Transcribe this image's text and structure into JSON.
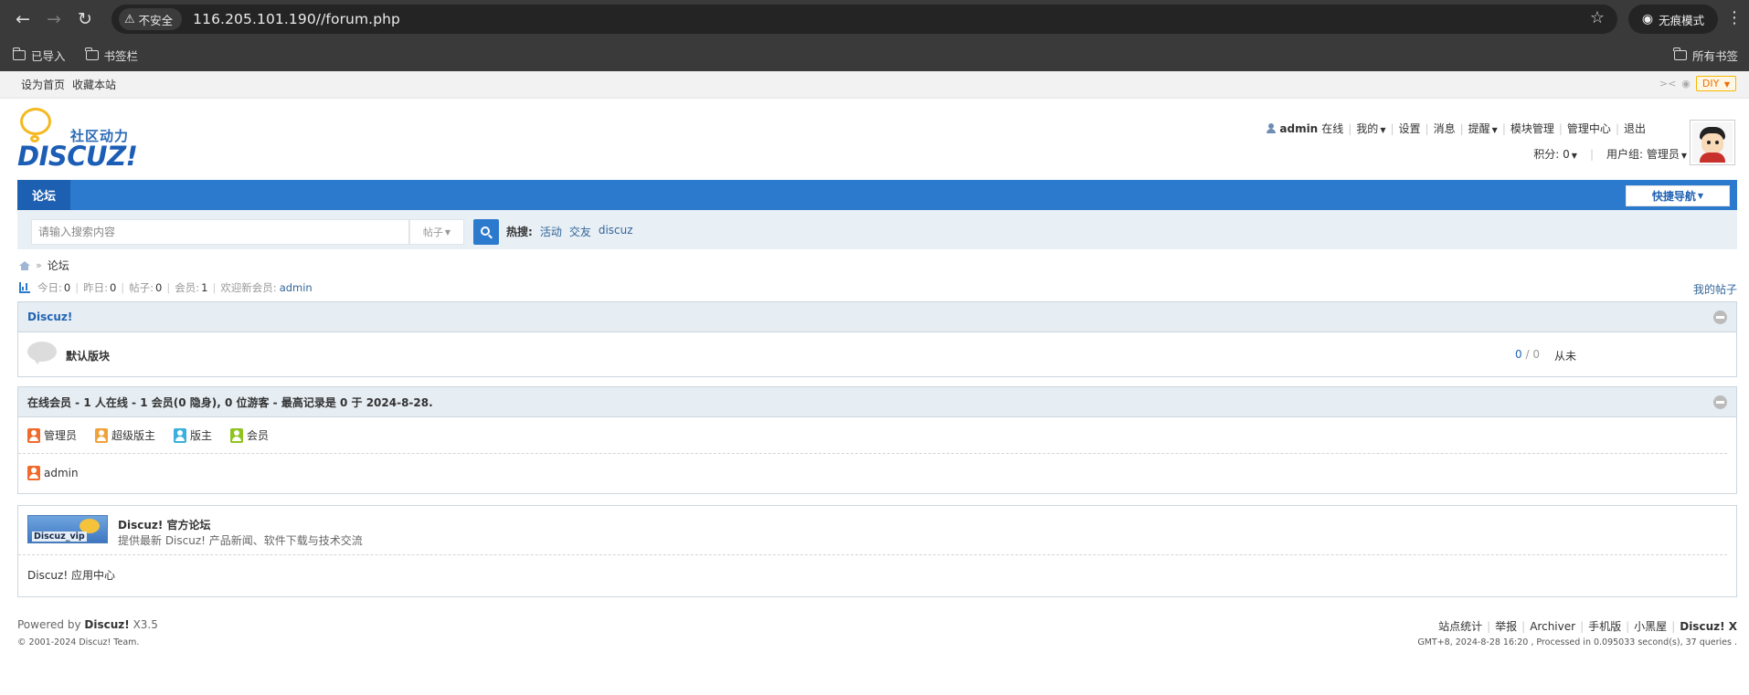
{
  "browser": {
    "security_label": "不安全",
    "url": "116.205.101.190//forum.php",
    "incognito_label": "无痕模式",
    "bookmarks": [
      "已导入",
      "书签栏"
    ],
    "all_bookmarks": "所有书签"
  },
  "topbar": {
    "set_home": "设为首页",
    "bookmark_site": "收藏本站",
    "diy": "DIY"
  },
  "logo": {
    "cn": "社区动力",
    "en": "DISCUZ!"
  },
  "user": {
    "name": "admin",
    "status": "在线",
    "links": [
      "我的",
      "设置",
      "消息",
      "提醒",
      "模块管理",
      "管理中心",
      "退出"
    ],
    "credits": "积分: 0",
    "group": "用户组: 管理员"
  },
  "nav": {
    "active_tab": "论坛",
    "quick_nav": "快捷导航"
  },
  "search": {
    "placeholder": "请输入搜索内容",
    "type": "帖子",
    "hot_label": "热搜:",
    "hot_terms": [
      "活动",
      "交友",
      "discuz"
    ]
  },
  "breadcrumb": {
    "current": "论坛"
  },
  "stats": {
    "today_label": "今日:",
    "today": "0",
    "yesterday_label": "昨日:",
    "yesterday": "0",
    "posts_label": "帖子:",
    "posts": "0",
    "members_label": "会员:",
    "members": "1",
    "welcome_label": "欢迎新会员:",
    "newest_member": "admin",
    "my_posts": "我的帖子"
  },
  "category": {
    "title": "Discuz!",
    "forums": [
      {
        "name": "默认版块",
        "threads": "0",
        "posts": "0",
        "last_post": "从未"
      }
    ]
  },
  "online": {
    "title": "在线会员 - 1 人在线 - 1 会员(0 隐身), 0 位游客 - 最高记录是 0 于 2024-8-28.",
    "legend": [
      "管理员",
      "超级版主",
      "版主",
      "会员"
    ],
    "users": [
      "admin"
    ]
  },
  "links": {
    "logo_text": "Discuz_vip",
    "title": "Discuz! 官方论坛",
    "desc": "提供最新 Discuz! 产品新闻、软件下载与技术交流",
    "app_center": "Discuz! 应用中心"
  },
  "footer": {
    "powered_by": "Powered by",
    "product": "Discuz!",
    "version": "X3.5",
    "copyright": "© 2001-2024 Discuz! Team.",
    "links": [
      "站点统计",
      "举报",
      "Archiver",
      "手机版",
      "小黑屋"
    ],
    "brand": "Discuz! X",
    "debug": "GMT+8, 2024-8-28 16:20 , Processed in 0.095033 second(s), 37 queries ."
  },
  "colors": {
    "nav_blue": "#2b7acd",
    "nav_active": "#1d5fb0",
    "link": "#336699",
    "box_header": "#e6edf3"
  }
}
